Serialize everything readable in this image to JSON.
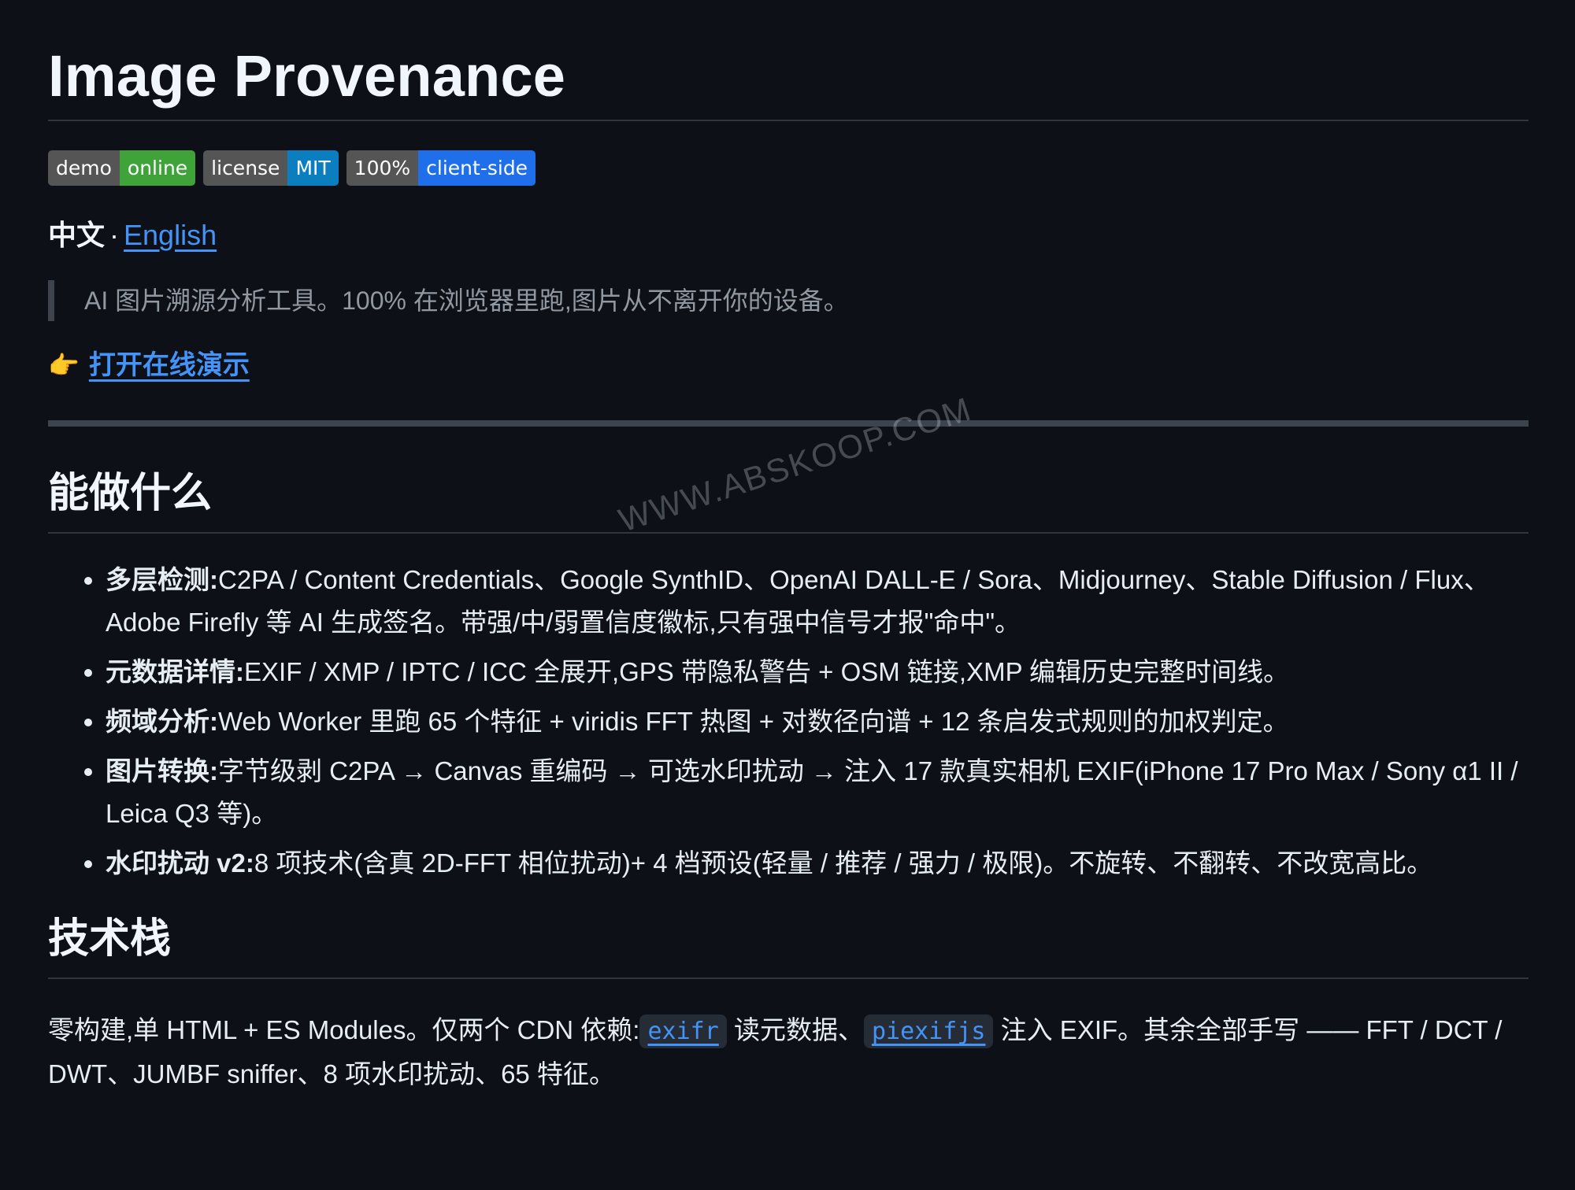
{
  "title": "Image Provenance",
  "badges": [
    {
      "key": "demo",
      "value": "online",
      "color": "#3fa33a"
    },
    {
      "key": "license",
      "value": "MIT",
      "color": "#0b7ec0"
    },
    {
      "key": "100%",
      "value": "client-side",
      "color": "#1f6feb"
    }
  ],
  "langs": {
    "current": "中文",
    "sep": "·",
    "other": "English"
  },
  "quote": "AI 图片溯源分析工具。100% 在浏览器里跑,图片从不离开你的设备。",
  "demo_link": {
    "icon": "👉",
    "label": "打开在线演示"
  },
  "section1": {
    "heading": "能做什么",
    "items": [
      {
        "bold": "多层检测:",
        "text": "C2PA / Content Credentials、Google SynthID、OpenAI DALL-E / Sora、Midjourney、Stable Diffusion / Flux、Adobe Firefly 等 AI 生成签名。带强/中/弱置信度徽标,只有强中信号才报\"命中\"。"
      },
      {
        "bold": "元数据详情:",
        "text": "EXIF / XMP / IPTC / ICC 全展开,GPS 带隐私警告 + OSM 链接,XMP 编辑历史完整时间线。"
      },
      {
        "bold": "频域分析:",
        "text": "Web Worker 里跑 65 个特征 + viridis FFT 热图 + 对数径向谱 + 12 条启发式规则的加权判定。"
      },
      {
        "bold": "图片转换:",
        "text": "字节级剥 C2PA → Canvas 重编码 → 可选水印扰动 → 注入 17 款真实相机 EXIF(iPhone 17 Pro Max / Sony α1 II / Leica Q3 等)。"
      },
      {
        "bold": "水印扰动 v2:",
        "text": "8 项技术(含真 2D-FFT 相位扰动)+ 4 档预设(轻量 / 推荐 / 强力 / 极限)。不旋转、不翻转、不改宽高比。"
      }
    ]
  },
  "section2": {
    "heading": "技术栈",
    "p_part1": "零构建,单 HTML + ES Modules。仅两个 CDN 依赖:",
    "code1": "exifr",
    "p_part2": " 读元数据、",
    "code2": "piexifjs",
    "p_part3": " 注入 EXIF。其余全部手写 —— FFT / DCT / DWT、JUMBF sniffer、8 项水印扰动、65 特征。"
  },
  "watermark": "WWW.ABSKOOP.COM"
}
